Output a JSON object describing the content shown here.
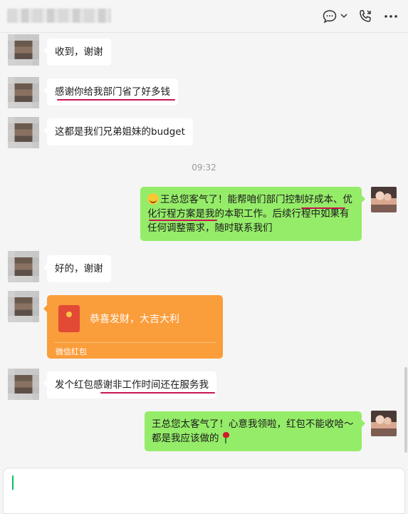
{
  "header": {
    "icons": [
      "chat-bubble-icon",
      "chevron-down-icon",
      "phone-icon",
      "more-icon"
    ]
  },
  "messages": {
    "m1": "收到，谢谢",
    "m2": "感谢你给我部门省了好多钱",
    "m3": "这都是我们兄弟姐妹的budget",
    "time": "09:32",
    "reply1": "王总您客气了！能帮咱们部门控制好成本、优化行程方案是我的本职工作。后续行程中如果有任何调整需求，随时联系我们",
    "m4": "好的，谢谢",
    "m5": "发个红包感谢非工作时间还在服务我",
    "reply2": "王总您太客气了！心意我领啦，红包不能收哈～都是我应该做的"
  },
  "red_packet": {
    "greeting": "恭喜发财，大吉大利",
    "footer": "微信红包"
  },
  "colors": {
    "sent_bubble": "#95ec69",
    "received_bubble": "#ffffff",
    "red_packet": "#fa9d3b",
    "annotation_underline": "#c8174f"
  }
}
